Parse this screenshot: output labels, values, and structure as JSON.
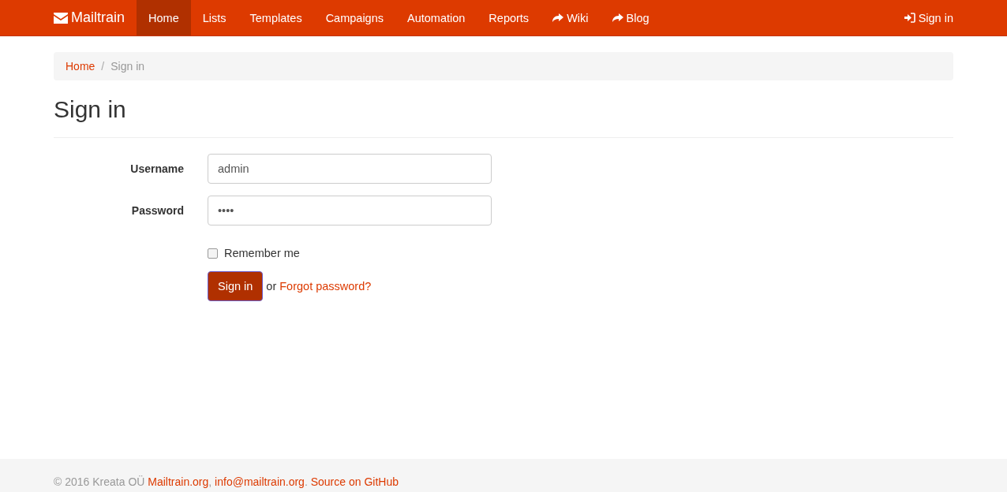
{
  "navbar": {
    "brand": "Mailtrain",
    "items": [
      {
        "label": "Home",
        "kind": "internal",
        "selected": true
      },
      {
        "label": "Lists",
        "kind": "internal",
        "selected": false
      },
      {
        "label": "Templates",
        "kind": "internal",
        "selected": false
      },
      {
        "label": "Campaigns",
        "kind": "internal",
        "selected": false
      },
      {
        "label": "Automation",
        "kind": "internal",
        "selected": false
      },
      {
        "label": "Reports",
        "kind": "internal",
        "selected": false
      },
      {
        "label": "Wiki",
        "kind": "external",
        "selected": false
      },
      {
        "label": "Blog",
        "kind": "external",
        "selected": false
      }
    ],
    "sign_in": "Sign in"
  },
  "breadcrumb": [
    {
      "label": "Home",
      "kind": "link"
    },
    {
      "label": "/",
      "kind": "separator"
    },
    {
      "label": "Sign in",
      "kind": "current"
    }
  ],
  "heading": "Sign in",
  "form": {
    "fields": [
      {
        "label": "Username",
        "value": "admin"
      },
      {
        "label": "Password",
        "value": "••••"
      }
    ],
    "remember": {
      "label": "Remember me",
      "checked": false
    },
    "submit": "Sign in",
    "or": "or",
    "forgot": "Forgot password?"
  },
  "footer": [
    {
      "kind": "text",
      "text": "© 2016 Kreata OÜ"
    },
    {
      "kind": "link",
      "text": "Mailtrain.org"
    },
    {
      "kind": "punct",
      "text": ","
    },
    {
      "kind": "link",
      "text": "info@mailtrain.org"
    },
    {
      "kind": "punct",
      "text": "."
    },
    {
      "kind": "link",
      "text": "Source on GitHub"
    }
  ]
}
